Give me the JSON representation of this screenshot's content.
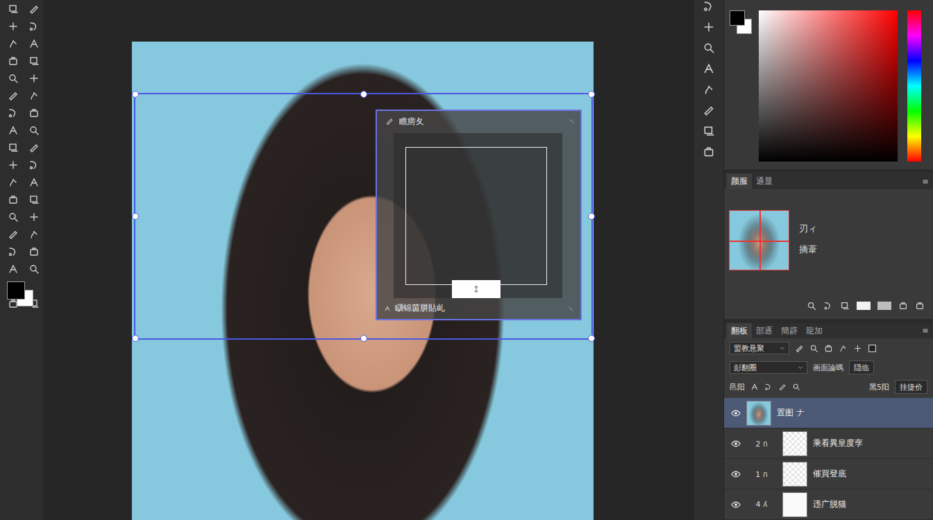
{
  "canvas": {
    "dialog": {
      "title": "瞧痨夂",
      "footer": "瞓锦茵肼貼乢"
    }
  },
  "navigator": {
    "tabs": [
      {
        "label": "颜服",
        "selected": true
      },
      {
        "label": "通显",
        "selected": false
      }
    ],
    "info": [
      "刃ィ",
      "摘葦"
    ]
  },
  "layers_panel": {
    "tabs": [
      {
        "label": "翻板",
        "selected": true
      },
      {
        "label": "部逐",
        "selected": false
      },
      {
        "label": "簡辟",
        "selected": false
      },
      {
        "label": "龍加",
        "selected": false
      }
    ],
    "blend_mode": "盟教悬聚",
    "filter": {
      "value": "彭翻圈",
      "label": "画面論嗎",
      "field": "隠临"
    },
    "lock": {
      "label": "邑阳",
      "fill_label": "黑5阳",
      "fill_field": "挂捷价"
    },
    "layers": [
      {
        "name": "置图 ナ",
        "badge": "",
        "kind": "photo",
        "visible": true,
        "selected": true
      },
      {
        "name": "乘看異皇度孪",
        "badge": "2 ก",
        "kind": "transparent",
        "visible": true,
        "selected": false
      },
      {
        "name": "催買登底",
        "badge": "1 ก",
        "kind": "transparent",
        "visible": true,
        "selected": false
      },
      {
        "name": "违广脱猫",
        "badge": "4 ʎ",
        "kind": "mask",
        "visible": true,
        "selected": false
      }
    ]
  }
}
